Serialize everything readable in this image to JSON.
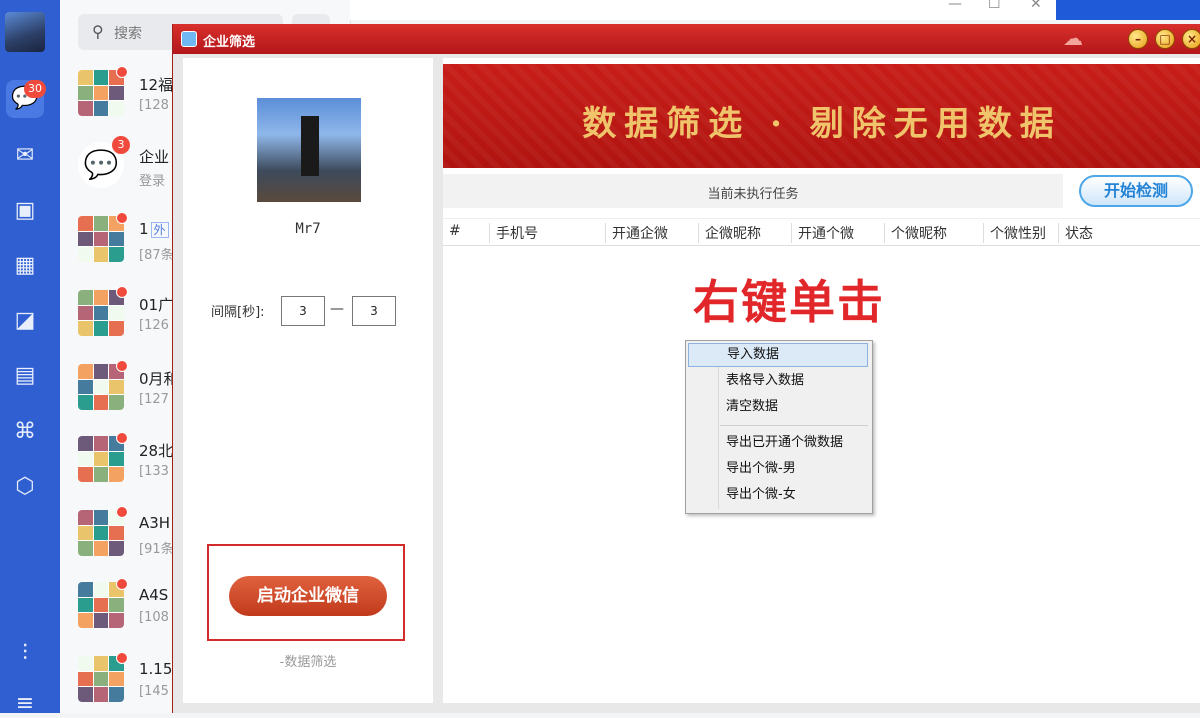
{
  "rail": {
    "badge": "30",
    "icons": [
      "chat-icon",
      "mail-icon",
      "docs-icon",
      "calendar-icon",
      "photos-icon",
      "apps-icon",
      "org-icon",
      "cube-icon",
      "settings-sliders-icon",
      "menu-icon"
    ]
  },
  "search": {
    "label": "搜索"
  },
  "chats": [
    {
      "name": "12福",
      "sub": "[128",
      "dot": true
    },
    {
      "name": "企业",
      "sub": "登录",
      "badge": "3",
      "logo": true
    },
    {
      "name": "1",
      "ext": "外",
      "sub": "[87条",
      "dot": true
    },
    {
      "name": "01广",
      "sub": "[126",
      "dot": true
    },
    {
      "name": "0月和",
      "sub": "[127",
      "dot": true
    },
    {
      "name": "28北",
      "sub": "[133",
      "dot": true
    },
    {
      "name": "A3H",
      "sub": "[91条",
      "dot": true
    },
    {
      "name": "A4S",
      "sub": "[108",
      "dot": true
    },
    {
      "name": "1.15",
      "sub": "[145",
      "dot": true
    }
  ],
  "dialog": {
    "title": "企业筛选",
    "username": "Mr7",
    "interval_label": "间隔[秒]:",
    "interval_from": "3",
    "interval_to": "3",
    "interval_dash": "—",
    "start_button": "启动企业微信",
    "footer": "-数据筛选",
    "banner": "数据筛选 · 剔除无用数据",
    "task_status": "当前未执行任务",
    "check_button": "开始检测",
    "columns": [
      "#",
      "手机号",
      "开通企微",
      "企微昵称",
      "开通个微",
      "个微昵称",
      "个微性别",
      "状态"
    ],
    "hint": "右键单击",
    "context_menu": [
      "导入数据",
      "表格导入数据",
      "清空数据",
      "导出已开通个微数据",
      "导出个微-男",
      "导出个微-女"
    ]
  },
  "colors": {
    "rail": "#2f5fd0",
    "title_red": "#c81d18",
    "banner_text": "#f0c46a",
    "hint_red": "#e2272a"
  }
}
